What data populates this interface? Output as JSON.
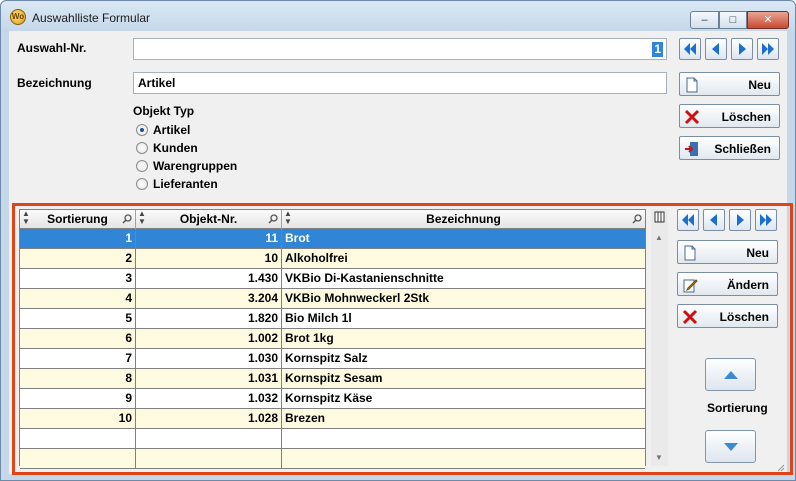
{
  "window": {
    "title": "Auswahlliste Formular",
    "icon_label": "Wo",
    "minimize_icon": "minimize-icon",
    "maximize_icon": "maximize-icon",
    "close_icon": "close-icon"
  },
  "form": {
    "auswahl_label": "Auswahl-Nr.",
    "auswahl_value": "1",
    "bezeichnung_label": "Bezeichnung",
    "bezeichnung_value": "Artikel",
    "objekt_typ_label": "Objekt Typ",
    "objekt_typ_options": [
      "Artikel",
      "Kunden",
      "Warengruppen",
      "Lieferanten"
    ],
    "objekt_typ_selected": "Artikel"
  },
  "top_buttons": {
    "neu": "Neu",
    "loeschen": "Löschen",
    "schliessen": "Schließen"
  },
  "grid": {
    "columns": [
      "Sortierung",
      "Objekt-Nr.",
      "Bezeichnung"
    ],
    "rows": [
      {
        "sortierung": "1",
        "objekt_nr": "11",
        "bezeichnung": "Brot"
      },
      {
        "sortierung": "2",
        "objekt_nr": "10",
        "bezeichnung": "Alkoholfrei"
      },
      {
        "sortierung": "3",
        "objekt_nr": "1.430",
        "bezeichnung": "VKBio Di-Kastanienschnitte"
      },
      {
        "sortierung": "4",
        "objekt_nr": "3.204",
        "bezeichnung": "VKBio Mohnweckerl 2Stk"
      },
      {
        "sortierung": "5",
        "objekt_nr": "1.820",
        "bezeichnung": "Bio Milch 1l"
      },
      {
        "sortierung": "6",
        "objekt_nr": "1.002",
        "bezeichnung": "Brot 1kg"
      },
      {
        "sortierung": "7",
        "objekt_nr": "1.030",
        "bezeichnung": "Kornspitz Salz"
      },
      {
        "sortierung": "8",
        "objekt_nr": "1.031",
        "bezeichnung": "Kornspitz Sesam"
      },
      {
        "sortierung": "9",
        "objekt_nr": "1.032",
        "bezeichnung": "Kornspitz Käse"
      },
      {
        "sortierung": "10",
        "objekt_nr": "1.028",
        "bezeichnung": "Brezen"
      }
    ],
    "selected_row": 0
  },
  "side_buttons": {
    "neu": "Neu",
    "aendern": "Ändern",
    "loeschen": "Löschen",
    "sortierung_label": "Sortierung"
  },
  "colors": {
    "highlight": "#e0451a",
    "selection": "#3185d6",
    "row_alt": "#fffbe1"
  }
}
